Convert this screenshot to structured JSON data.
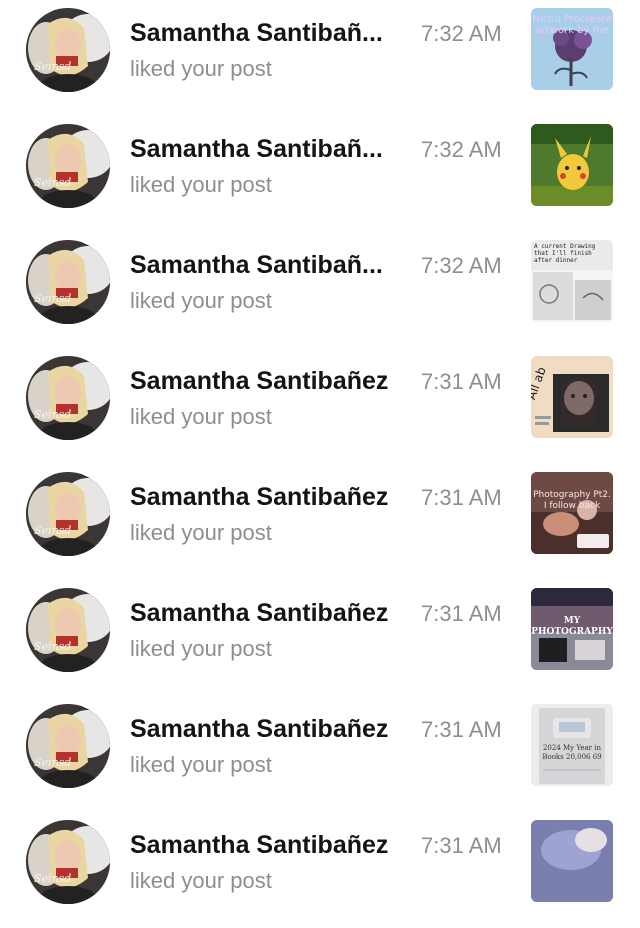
{
  "notifications": [
    {
      "name": "Samantha Santibañ...",
      "time": "7:32 AM",
      "action": "liked your post",
      "thumb_caption": "Nichd Procreate artwork by me",
      "thumb_icon": "procreate-art-thumbnail"
    },
    {
      "name": "Samantha Santibañ...",
      "time": "7:32 AM",
      "action": "liked your post",
      "thumb_caption": "",
      "thumb_icon": "pikachu-art-thumbnail"
    },
    {
      "name": "Samantha Santibañ...",
      "time": "7:32 AM",
      "action": "liked your post",
      "thumb_caption": "A current Drawing that I'll finish after dinner",
      "thumb_icon": "drawing-thumbnail"
    },
    {
      "name": "Samantha Santibañez",
      "time": "7:31 AM",
      "action": "liked your post",
      "thumb_caption": "All ab",
      "thumb_icon": "selfie-collage-thumbnail"
    },
    {
      "name": "Samantha Santibañez",
      "time": "7:31 AM",
      "action": "liked your post",
      "thumb_caption": "Photography Pt2. I follow back",
      "thumb_icon": "photography-thumbnail"
    },
    {
      "name": "Samantha Santibañez",
      "time": "7:31 AM",
      "action": "liked your post",
      "thumb_caption": "MY PHOTOGRAPHY",
      "thumb_icon": "my-photography-thumbnail"
    },
    {
      "name": "Samantha Santibañez",
      "time": "7:31 AM",
      "action": "liked your post",
      "thumb_caption": "2024 My Year in Books 20,006 69",
      "thumb_icon": "year-in-books-thumbnail"
    },
    {
      "name": "Samantha Santibañez",
      "time": "7:31 AM",
      "action": "liked your post",
      "thumb_caption": "",
      "thumb_icon": "photo-thumbnail"
    }
  ],
  "colors": {
    "name": "#141414",
    "secondary": "#8e8e8e",
    "background": "#ffffff"
  }
}
